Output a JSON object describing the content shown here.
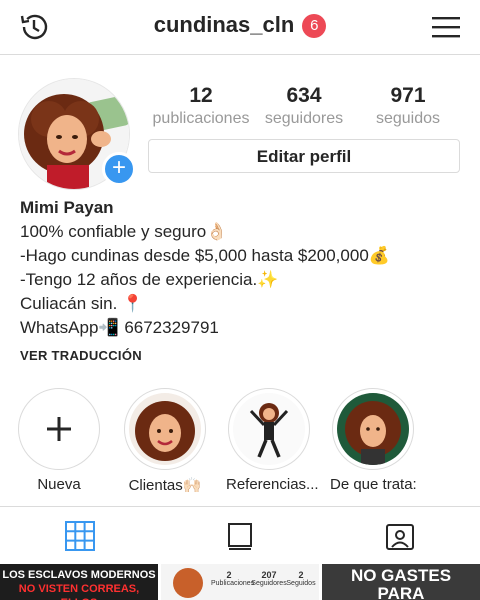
{
  "header": {
    "username": "cundinas_cln",
    "notification_count": "6"
  },
  "stats": [
    {
      "value": "12",
      "label": "publicaciones"
    },
    {
      "value": "634",
      "label": "seguidores"
    },
    {
      "value": "971",
      "label": "seguidos"
    }
  ],
  "edit_profile_label": "Editar perfil",
  "bio": {
    "name": "Mimi Payan",
    "lines": [
      "100% confiable y seguro👌🏻",
      "-Hago cundinas desde $5,000 hasta $200,000💰",
      "-Tengo 12 años de experiencia.✨",
      "Culiacán sin. 📍",
      "WhatsApp📲 6672329791"
    ]
  },
  "see_translation": "VER TRADUCCIÓN",
  "highlights": [
    {
      "label": "Nueva"
    },
    {
      "label": "Clientas🙌🏻"
    },
    {
      "label": "Referencias..."
    },
    {
      "label": "De que trata:"
    }
  ],
  "posts": {
    "post1_line1": "LOS ESCLAVOS MODERNOS",
    "post1_line2": "NO VISTEN CORREAS, ELLOS",
    "post2_stats": [
      {
        "value": "2",
        "label": "Publicaciones"
      },
      {
        "value": "207",
        "label": "Seguidores"
      },
      {
        "value": "2",
        "label": "Seguidos"
      }
    ],
    "post3_line1": "NO GASTES",
    "post3_line2": "PARA"
  },
  "colors": {
    "badge": "#ed4956",
    "accent": "#3897f0",
    "tab_active": "#3897f0"
  }
}
